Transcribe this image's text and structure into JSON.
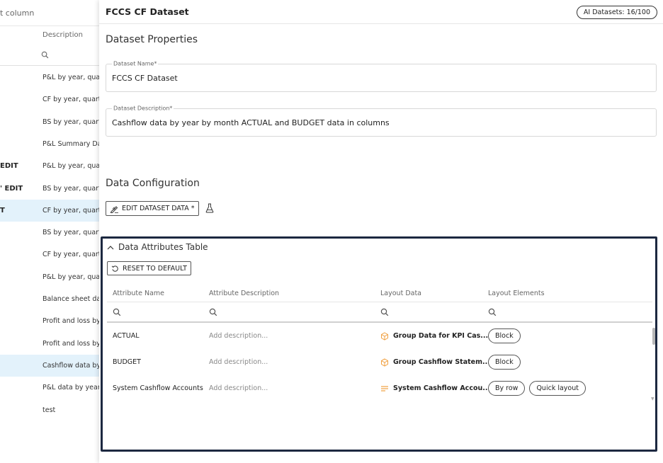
{
  "left_panel": {
    "header": "t column",
    "column_header": "Description",
    "rows": [
      {
        "name": "",
        "desc": "P&L by year, quart",
        "highlight": false
      },
      {
        "name": "",
        "desc": "CF by year, quarte",
        "highlight": false
      },
      {
        "name": "",
        "desc": "BS by year, quarte",
        "highlight": false
      },
      {
        "name": "",
        "desc": "P&L Summary Dat",
        "highlight": false
      },
      {
        "name": "EDIT",
        "desc": "P&L by year, quart",
        "highlight": false
      },
      {
        "name": "' EDIT",
        "desc": "BS by year, quarte",
        "highlight": false
      },
      {
        "name": "T",
        "desc": "CF by year, quarte",
        "highlight": true
      },
      {
        "name": "",
        "desc": "BS by year, quarte",
        "highlight": false
      },
      {
        "name": "",
        "desc": "CF by year, quarte",
        "highlight": false
      },
      {
        "name": "",
        "desc": "P&L by year, quart",
        "highlight": false
      },
      {
        "name": "",
        "desc": "Balance sheet dat",
        "highlight": false
      },
      {
        "name": "",
        "desc": "Profit and loss by",
        "highlight": false
      },
      {
        "name": "",
        "desc": "Profit and loss by",
        "highlight": false
      },
      {
        "name": "",
        "desc": "Cashflow data by y",
        "highlight": true
      },
      {
        "name": "",
        "desc": "P&L data by year,",
        "highlight": false
      },
      {
        "name": "",
        "desc": "test",
        "highlight": false
      }
    ]
  },
  "header": {
    "title": "FCCS CF Dataset",
    "ai_badge": "AI Datasets: 16/100"
  },
  "properties": {
    "title": "Dataset Properties",
    "name_label": "Dataset Name*",
    "name_value": "FCCS CF Dataset",
    "desc_label": "Dataset Description*",
    "desc_value": "Cashflow data by year by month ACTUAL and BUDGET data in columns"
  },
  "configuration": {
    "title": "Data Configuration",
    "edit_button": "EDIT DATASET DATA *"
  },
  "attributes": {
    "title": "Data Attributes Table",
    "reset_button": "RESET TO DEFAULT",
    "columns": [
      "Attribute Name",
      "Attribute Description",
      "Layout Data",
      "Layout Elements"
    ],
    "rows": [
      {
        "name": "ACTUAL",
        "desc": "Add description...",
        "layout_icon": "cube-icon",
        "layout": "Group Data for KPI Cas...",
        "elements": [
          "Block"
        ]
      },
      {
        "name": "BUDGET",
        "desc": "Add description...",
        "layout_icon": "cube-icon",
        "layout": "Group Cashflow Statem...",
        "elements": [
          "Block"
        ]
      },
      {
        "name": "System Cashflow Accounts",
        "desc": "Add description...",
        "layout_icon": "lines-icon",
        "layout": "System Cashflow Accou...",
        "elements": [
          "By row",
          "Quick layout"
        ]
      }
    ]
  },
  "colors": {
    "accent_orange": "#f0a040",
    "panel_border": "#1c2840",
    "row_highlight": "#e3f2fb"
  }
}
